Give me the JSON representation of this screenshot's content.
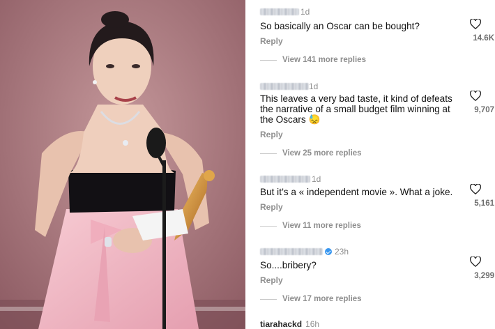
{
  "comments": [
    {
      "time": "1d",
      "text": "So basically an Oscar can be bought?",
      "reply_label": "Reply",
      "likes": "14.6K",
      "view_replies": "View 141 more replies"
    },
    {
      "time": "1d",
      "text": "This leaves a very bad taste, it kind of defeats the narrative of a small budget film winning at the Oscars 😓",
      "reply_label": "Reply",
      "likes": "9,707",
      "view_replies": "View 25 more replies"
    },
    {
      "time": "1d",
      "text": "But it’s a «  independent movie ». What a joke.",
      "reply_label": "Reply",
      "likes": "5,161",
      "view_replies": "View 11 more replies"
    },
    {
      "time": "23h",
      "text": "So....bribery?",
      "reply_label": "Reply",
      "likes": "3,299",
      "view_replies": "View 17 more replies"
    }
  ],
  "last_comment": {
    "username": "tiarahackd",
    "time": "16h"
  },
  "icons": {
    "like": "heart-icon",
    "verified": "verified-badge-icon"
  },
  "colors": {
    "secondary_text": "#8e8e8e",
    "verified_blue": "#3897f0",
    "dress_pink": "#f2b9c4"
  }
}
